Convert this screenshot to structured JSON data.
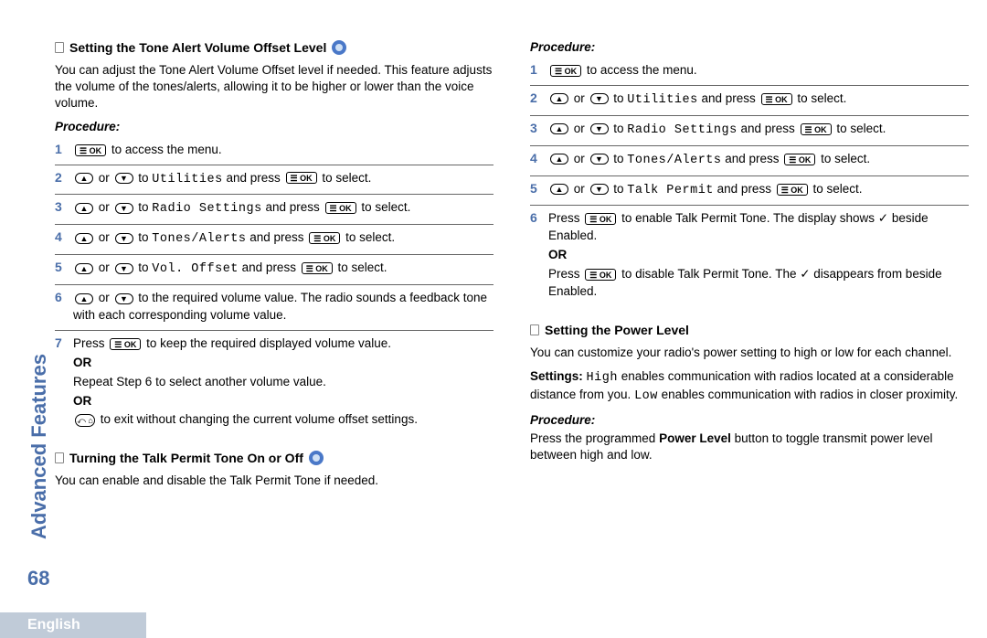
{
  "sidebar": {
    "section": "Advanced Features",
    "page_num": "68",
    "language": "English"
  },
  "sec1": {
    "heading": "Setting the Tone Alert Volume Offset Level",
    "intro": "You can adjust the Tone Alert Volume Offset level if needed. This feature adjusts the volume of the tones/alerts, allowing it to be higher or lower than the voice volume.",
    "proc_label": "Procedure:",
    "steps": {
      "s1_a": " to access the menu.",
      "s2_a": " or ",
      "s2_b": " to ",
      "s2_menu": "Utilities",
      "s2_c": " and press ",
      "s2_d": " to select.",
      "s3_a": " or ",
      "s3_b": " to ",
      "s3_menu": "Radio Settings",
      "s3_c": " and press ",
      "s3_d": " to select.",
      "s4_a": " or ",
      "s4_b": " to ",
      "s4_menu": "Tones/Alerts",
      "s4_c": " and press ",
      "s4_d": " to select.",
      "s5_a": " or ",
      "s5_b": " to ",
      "s5_menu": "Vol. Offset",
      "s5_c": " and press ",
      "s5_d": " to select.",
      "s6_a": " or ",
      "s6_b": " to the required volume value. The radio sounds a feedback tone with each corresponding volume value.",
      "s7_a": "Press ",
      "s7_b": " to keep the required displayed volume value.",
      "s7_or1": "OR",
      "s7_c": "Repeat Step 6 to select another volume value.",
      "s7_or2": "OR",
      "s7_d": " to exit without changing the current volume offset settings."
    }
  },
  "sec2": {
    "heading": "Turning the Talk Permit Tone On or Off",
    "intro": "You can enable and disable the Talk Permit Tone if needed.",
    "proc_label": "Procedure:",
    "steps": {
      "s1_a": " to access the menu.",
      "s2_a": " or ",
      "s2_b": " to ",
      "s2_menu": "Utilities",
      "s2_c": " and press ",
      "s2_d": " to select.",
      "s3_a": " or ",
      "s3_b": " to ",
      "s3_menu": "Radio Settings",
      "s3_c": " and press ",
      "s3_d": " to select.",
      "s4_a": " or ",
      "s4_b": " to ",
      "s4_menu": "Tones/Alerts",
      "s4_c": " and press ",
      "s4_d": " to select.",
      "s5_a": " or ",
      "s5_b": " to ",
      "s5_menu": "Talk Permit",
      "s5_c": " and press ",
      "s5_d": " to select.",
      "s6_a": "Press ",
      "s6_b": " to enable Talk Permit Tone. The display shows ✓ beside Enabled.",
      "s6_or": "OR",
      "s6_c": "Press ",
      "s6_d": " to disable Talk Permit Tone. The ✓ disappears from beside Enabled."
    }
  },
  "sec3": {
    "heading": "Setting the Power Level",
    "intro": "You can customize your radio's power setting to high or low for each channel.",
    "settings_label": "Settings:",
    "settings_a": " enables communication with radios located at a considerable distance from you. ",
    "settings_high": "High",
    "settings_low": "Low",
    "settings_b": " enables communication with radios in closer proximity.",
    "proc_label": "Procedure:",
    "proc_a": "Press the programmed ",
    "proc_btn": "Power Level",
    "proc_b": " button to toggle transmit power level between high and low."
  },
  "keys": {
    "ok": "☰ OK",
    "up": "▲",
    "down": "▼",
    "back": "⤺ ⌂"
  },
  "nums": {
    "n1": "1",
    "n2": "2",
    "n3": "3",
    "n4": "4",
    "n5": "5",
    "n6": "6",
    "n7": "7"
  }
}
